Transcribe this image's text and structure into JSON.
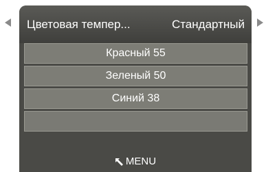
{
  "nav": {
    "left_icon": "triangle-left-icon",
    "right_icon": "triangle-right-icon"
  },
  "header": {
    "title": "Цветовая темпер...",
    "value": "Стандартный"
  },
  "rows": [
    {
      "label": "Красный 55"
    },
    {
      "label": "Зеленый 50"
    },
    {
      "label": "Синий 38"
    },
    {
      "label": ""
    }
  ],
  "footer": {
    "icon": "return-arrow-icon",
    "label": "MENU"
  },
  "colors": {
    "panel": "#4a4a46",
    "row": "#7d7d76",
    "arrow": "#8a8a8a",
    "text": "#ffffff"
  }
}
